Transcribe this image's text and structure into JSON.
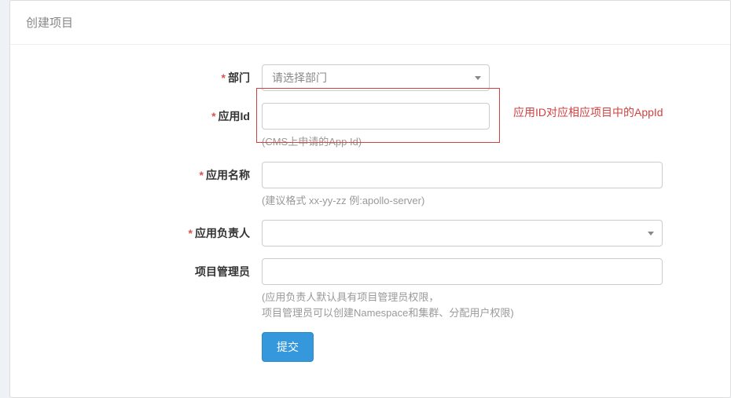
{
  "panel": {
    "title": "创建项目"
  },
  "form": {
    "department": {
      "label": "部门",
      "placeholder": "请选择部门",
      "value": ""
    },
    "appId": {
      "label": "应用Id",
      "value": "",
      "help": "(CMS上申请的App Id)"
    },
    "appName": {
      "label": "应用名称",
      "value": "",
      "help": "(建议格式 xx-yy-zz 例:apollo-server)"
    },
    "owner": {
      "label": "应用负责人",
      "value": ""
    },
    "admin": {
      "label": "项目管理员",
      "value": "",
      "help1": "(应用负责人默认具有项目管理员权限，",
      "help2": "项目管理员可以创建Namespace和集群、分配用户权限)"
    },
    "submit": "提交"
  },
  "annotation": {
    "text": "应用ID对应相应项目中的AppId"
  }
}
